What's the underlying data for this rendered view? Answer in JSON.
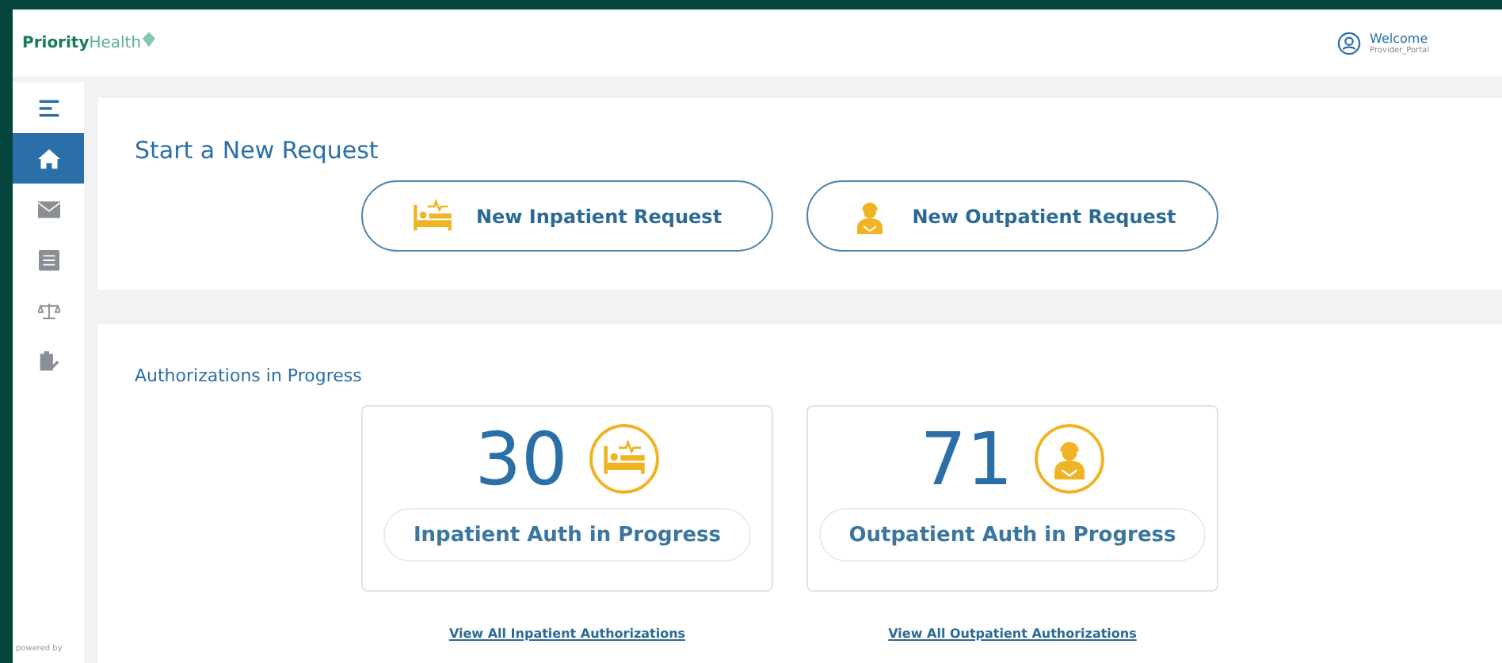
{
  "header": {
    "logo": {
      "bold": "Priority",
      "light": "Health"
    },
    "welcome": "Welcome",
    "user": "Provider_Portal"
  },
  "sidebar": {
    "items": [
      {
        "kind": "menu",
        "selected": false
      },
      {
        "kind": "home",
        "selected": true
      },
      {
        "kind": "mail",
        "selected": false
      },
      {
        "kind": "list",
        "selected": false
      },
      {
        "kind": "scale",
        "selected": false
      },
      {
        "kind": "clipboard",
        "selected": false
      }
    ],
    "footer": "powered by"
  },
  "new_request": {
    "title": "Start a New Request",
    "buttons": [
      {
        "kind": "bed",
        "label": "New Inpatient Request"
      },
      {
        "kind": "person",
        "label": "New Outpatient Request"
      }
    ]
  },
  "in_progress": {
    "title": "Authorizations in Progress",
    "cards": [
      {
        "kind": "bed",
        "count": "30",
        "label": "Inpatient Auth in Progress",
        "link": "View All Inpatient Authorizations"
      },
      {
        "kind": "person",
        "count": "71",
        "label": "Outpatient Auth in Progress",
        "link": "View All Outpatient Authorizations"
      }
    ]
  }
}
